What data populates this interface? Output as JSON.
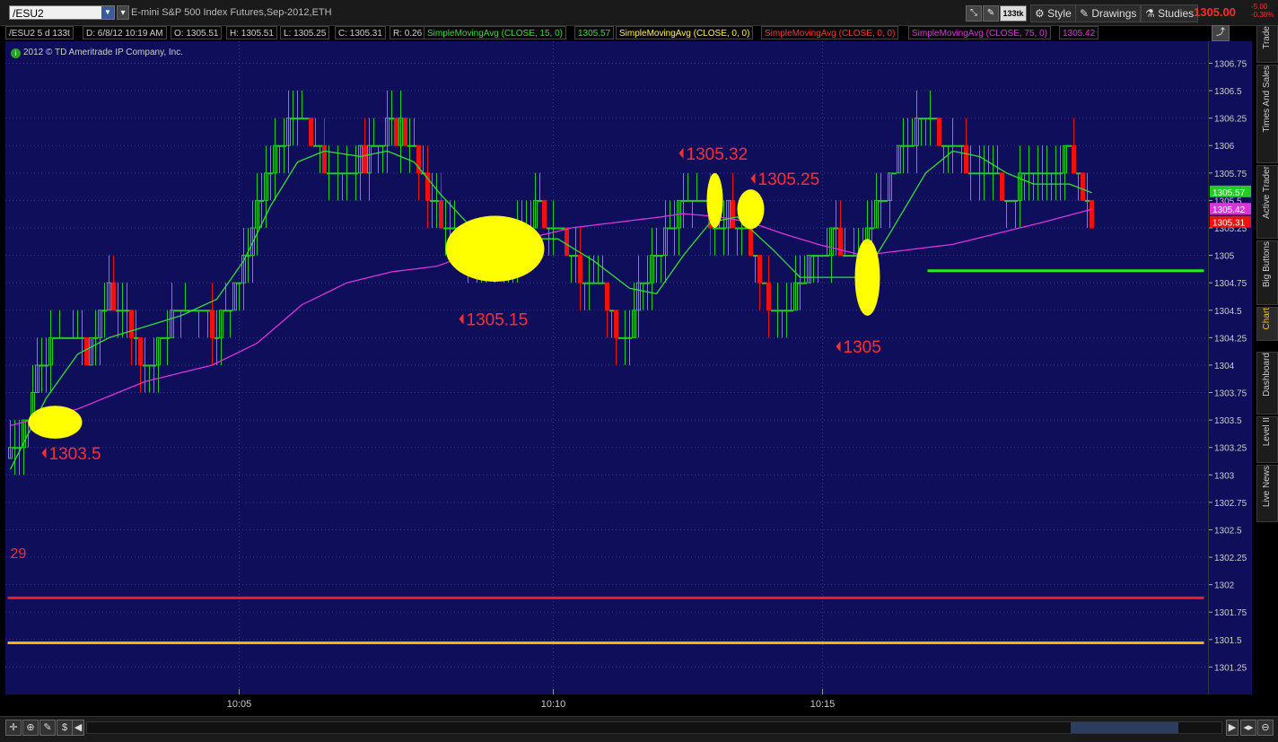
{
  "header": {
    "symbol": "/ESU2",
    "description": "E-mini S&P 500 Index Futures,Sep-2012,ETH",
    "tick_label": "133tk",
    "style_label": "Style",
    "drawings_label": "Drawings",
    "studies_label": "Studies",
    "last_price": "1305.00",
    "change_abs": "-5.00",
    "change_pct": "-0.38%"
  },
  "infobar": {
    "period": "/ESU2 5 d 133t",
    "date": "D: 6/8/12 10:19 AM",
    "open": "O: 1305.51",
    "high": "H: 1305.51",
    "low": "L: 1305.25",
    "close": "C: 1305.31",
    "range": "R: 0.26",
    "sma15_label": "SimpleMovingAvg (CLOSE, 15, 0)",
    "sma15_value": "1305.57",
    "sma0a_label": "SimpleMovingAvg (CLOSE, 0, 0)",
    "sma0b_label": "SimpleMovingAvg (CLOSE, 0, 0)",
    "sma75_label": "SimpleMovingAvg (CLOSE, 75, 0)",
    "sma75_value": "1305.42",
    "copyright": "2012 © TD Ameritrade IP Company, Inc."
  },
  "side_tabs": [
    "Trade",
    "Times And Sales",
    "Active Trader",
    "Big Buttons",
    "Chart",
    "Dashboard",
    "Level II",
    "Live News"
  ],
  "colors": {
    "background": "#0e0e5a",
    "up": "#22cc22",
    "down": "#ee1111",
    "sma15": "#33dd33",
    "sma75": "#dd33dd",
    "annotation": "#ff3030",
    "highlight": "#ffff00",
    "red_level": "#ff1a1a",
    "orange_level": "#ffb000",
    "green_level": "#22ee22"
  },
  "chart_data": {
    "type": "candlestick",
    "title": "/ESU2 5 d 133t",
    "xlabel": "",
    "ylabel": "",
    "ylim": [
      1301.0,
      1306.95
    ],
    "y_ticks": [
      "1306.75",
      "1306.5",
      "1306.25",
      "1306",
      "1305.75",
      "1305.5",
      "1305.25",
      "1305",
      "1304.75",
      "1304.5",
      "1304.25",
      "1304",
      "1303.75",
      "1303.5",
      "1303.25",
      "1303",
      "1302.75",
      "1302.5",
      "1302.25",
      "1302",
      "1301.75",
      "1301.5",
      "1301.25"
    ],
    "x_ticks": [
      {
        "label": "10:05",
        "bar": 51
      },
      {
        "label": "10:10",
        "bar": 121
      },
      {
        "label": "10:15",
        "bar": 181
      }
    ],
    "bar_count": 242,
    "anchors": [
      [
        0,
        1303.15
      ],
      [
        3,
        1303.4
      ],
      [
        7,
        1304.1
      ],
      [
        12,
        1304.35
      ],
      [
        17,
        1304.1
      ],
      [
        22,
        1304.7
      ],
      [
        27,
        1304.3
      ],
      [
        30,
        1303.95
      ],
      [
        35,
        1304.4
      ],
      [
        40,
        1304.55
      ],
      [
        46,
        1304.3
      ],
      [
        52,
        1304.9
      ],
      [
        56,
        1305.55
      ],
      [
        60,
        1306.0
      ],
      [
        64,
        1306.35
      ],
      [
        69,
        1305.95
      ],
      [
        73,
        1305.7
      ],
      [
        78,
        1305.85
      ],
      [
        83,
        1306.1
      ],
      [
        88,
        1306.15
      ],
      [
        93,
        1305.6
      ],
      [
        98,
        1305.15
      ],
      [
        103,
        1305.05
      ],
      [
        108,
        1304.95
      ],
      [
        113,
        1305.2
      ],
      [
        118,
        1305.4
      ],
      [
        122,
        1305.3
      ],
      [
        127,
        1304.85
      ],
      [
        132,
        1304.6
      ],
      [
        136,
        1304.25
      ],
      [
        140,
        1304.6
      ],
      [
        145,
        1305.1
      ],
      [
        150,
        1305.6
      ],
      [
        154,
        1305.55
      ],
      [
        157,
        1305.2
      ],
      [
        160,
        1305.4
      ],
      [
        163,
        1305.2
      ],
      [
        167,
        1304.8
      ],
      [
        170,
        1304.4
      ],
      [
        174,
        1304.6
      ],
      [
        178,
        1305.0
      ],
      [
        183,
        1305.15
      ],
      [
        187,
        1304.95
      ],
      [
        190,
        1305.1
      ],
      [
        195,
        1305.55
      ],
      [
        199,
        1306.0
      ],
      [
        203,
        1306.3
      ],
      [
        207,
        1306.05
      ],
      [
        212,
        1305.9
      ],
      [
        217,
        1305.75
      ],
      [
        222,
        1305.55
      ],
      [
        227,
        1305.65
      ],
      [
        232,
        1305.8
      ],
      [
        236,
        1305.85
      ],
      [
        241,
        1305.3
      ]
    ],
    "sma15_anchors": [
      [
        0,
        1303.05
      ],
      [
        8,
        1303.7
      ],
      [
        15,
        1304.1
      ],
      [
        22,
        1304.25
      ],
      [
        30,
        1304.35
      ],
      [
        38,
        1304.45
      ],
      [
        46,
        1304.6
      ],
      [
        52,
        1304.95
      ],
      [
        58,
        1305.45
      ],
      [
        64,
        1305.85
      ],
      [
        70,
        1305.95
      ],
      [
        78,
        1305.9
      ],
      [
        84,
        1305.95
      ],
      [
        90,
        1305.85
      ],
      [
        96,
        1305.55
      ],
      [
        104,
        1305.2
      ],
      [
        110,
        1305.05
      ],
      [
        116,
        1305.15
      ],
      [
        122,
        1305.15
      ],
      [
        130,
        1304.95
      ],
      [
        138,
        1304.7
      ],
      [
        144,
        1304.65
      ],
      [
        150,
        1305.0
      ],
      [
        156,
        1305.3
      ],
      [
        162,
        1305.35
      ],
      [
        170,
        1305.05
      ],
      [
        176,
        1304.8
      ],
      [
        184,
        1304.8
      ],
      [
        190,
        1304.8
      ],
      [
        196,
        1305.2
      ],
      [
        204,
        1305.75
      ],
      [
        210,
        1305.95
      ],
      [
        216,
        1305.9
      ],
      [
        222,
        1305.75
      ],
      [
        228,
        1305.65
      ],
      [
        236,
        1305.65
      ],
      [
        241,
        1305.57
      ]
    ],
    "sma75_anchors": [
      [
        0,
        1303.45
      ],
      [
        15,
        1303.6
      ],
      [
        30,
        1303.85
      ],
      [
        45,
        1304.0
      ],
      [
        55,
        1304.2
      ],
      [
        65,
        1304.55
      ],
      [
        75,
        1304.75
      ],
      [
        85,
        1304.85
      ],
      [
        95,
        1304.9
      ],
      [
        105,
        1305.05
      ],
      [
        115,
        1305.15
      ],
      [
        125,
        1305.25
      ],
      [
        135,
        1305.3
      ],
      [
        145,
        1305.35
      ],
      [
        150,
        1305.38
      ],
      [
        158,
        1305.35
      ],
      [
        165,
        1305.3
      ],
      [
        172,
        1305.2
      ],
      [
        180,
        1305.1
      ],
      [
        190,
        1305.0
      ],
      [
        200,
        1305.05
      ],
      [
        210,
        1305.1
      ],
      [
        220,
        1305.2
      ],
      [
        230,
        1305.3
      ],
      [
        241,
        1305.42
      ]
    ],
    "annotations": [
      {
        "text": "1303.5",
        "bar": 7,
        "price": 1303.2
      },
      {
        "text": "1305.15",
        "bar": 100,
        "price": 1304.42
      },
      {
        "text": "1305.32",
        "bar": 149,
        "price": 1305.93
      },
      {
        "text": "1305.25",
        "bar": 165,
        "price": 1305.7
      },
      {
        "text": "1305",
        "bar": 184,
        "price": 1304.17
      },
      {
        "text": "29",
        "bar": 0,
        "price": 1302.3
      }
    ],
    "highlights": [
      {
        "bar": 10,
        "price": 1303.48,
        "rx_bars": 6,
        "ry_price": 0.15
      },
      {
        "bar": 108,
        "price": 1305.06,
        "rx_bars": 11,
        "ry_price": 0.3
      },
      {
        "bar": 157,
        "price": 1305.5,
        "rx_bars": 1.8,
        "ry_price": 0.25
      },
      {
        "bar": 165,
        "price": 1305.42,
        "rx_bars": 3,
        "ry_price": 0.18
      },
      {
        "bar": 191,
        "price": 1304.8,
        "rx_bars": 2.8,
        "ry_price": 0.35
      }
    ],
    "levels": [
      {
        "price": 1301.88,
        "color": "red_level",
        "from_bar": 0,
        "to_bar": 266
      },
      {
        "price": 1301.47,
        "color": "orange_level",
        "from_bar": 0,
        "to_bar": 266
      },
      {
        "price": 1304.86,
        "color": "green_level",
        "from_bar": 205,
        "to_bar": 266
      }
    ],
    "price_tags": [
      {
        "text": "1305.57",
        "price": 1305.57,
        "color": "#22cc22"
      },
      {
        "text": "1305.42",
        "price": 1305.42,
        "color": "#dd33dd"
      },
      {
        "text": "1305.31",
        "price": 1305.31,
        "color": "#ee1111"
      }
    ]
  }
}
